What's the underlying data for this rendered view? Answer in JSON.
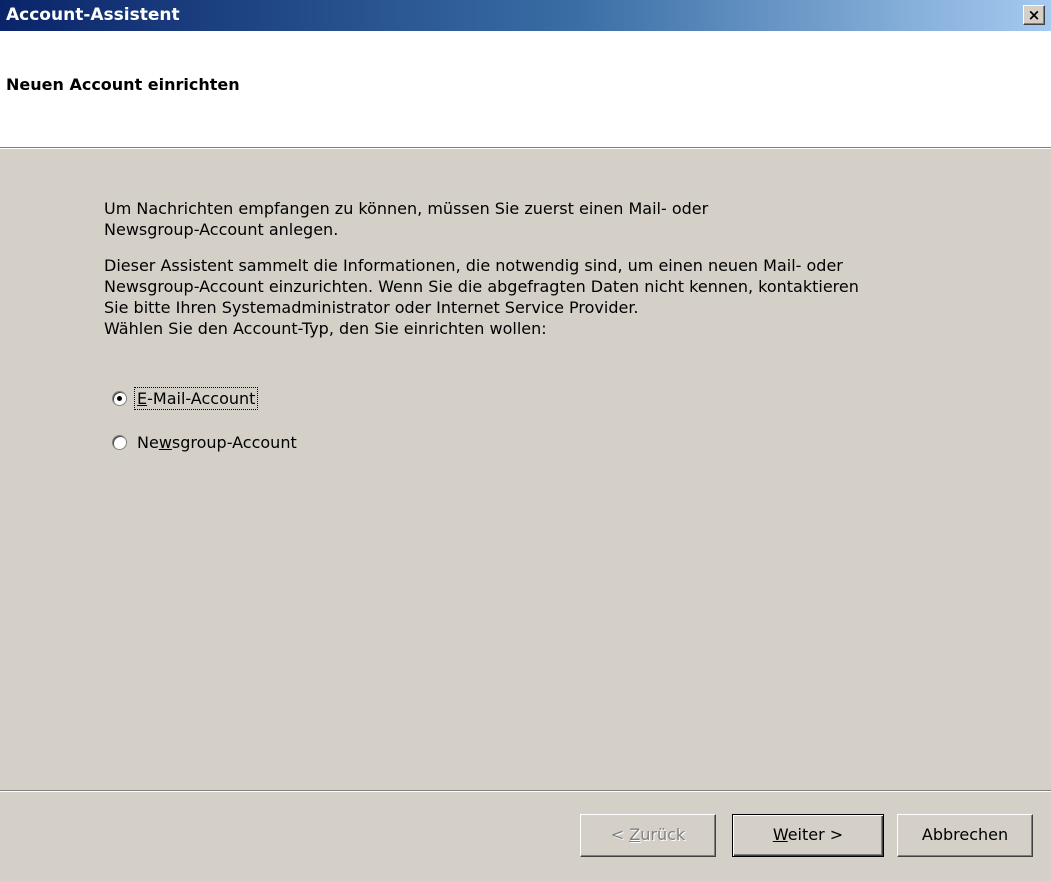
{
  "window": {
    "title": "Account-Assistent",
    "close_label": "×"
  },
  "header": {
    "heading": "Neuen Account einrichten"
  },
  "content": {
    "paragraph1": "Um Nachrichten empfangen zu können, müssen Sie zuerst einen Mail- oder\nNewsgroup-Account anlegen.",
    "paragraph2": "Dieser Assistent sammelt die Informationen, die notwendig sind, um einen neuen Mail- oder\nNewsgroup-Account einzurichten. Wenn Sie die abgefragten Daten nicht kennen, kontaktieren\nSie bitte Ihren Systemadministrator oder Internet Service Provider.",
    "paragraph3": "Wählen Sie den Account-Typ, den Sie einrichten wollen:"
  },
  "account_types": [
    {
      "label_mnemonic": "E",
      "label_rest": "-Mail-Account",
      "selected": true
    },
    {
      "label_pre": "Ne",
      "label_mnemonic": "w",
      "label_rest": "sgroup-Account",
      "selected": false
    }
  ],
  "buttons": {
    "back": {
      "pre": "< ",
      "mnemonic": "Z",
      "rest": "urück",
      "enabled": false
    },
    "next": {
      "mnemonic": "W",
      "rest": "eiter >",
      "enabled": true
    },
    "cancel": {
      "label": "Abbrechen",
      "enabled": true
    }
  },
  "colors": {
    "dialog_bg": "#d4d0c8",
    "title_gradient_start": "#0a246a",
    "title_gradient_end": "#a6caf0",
    "header_bg": "#ffffff",
    "disabled_text": "#808080"
  }
}
